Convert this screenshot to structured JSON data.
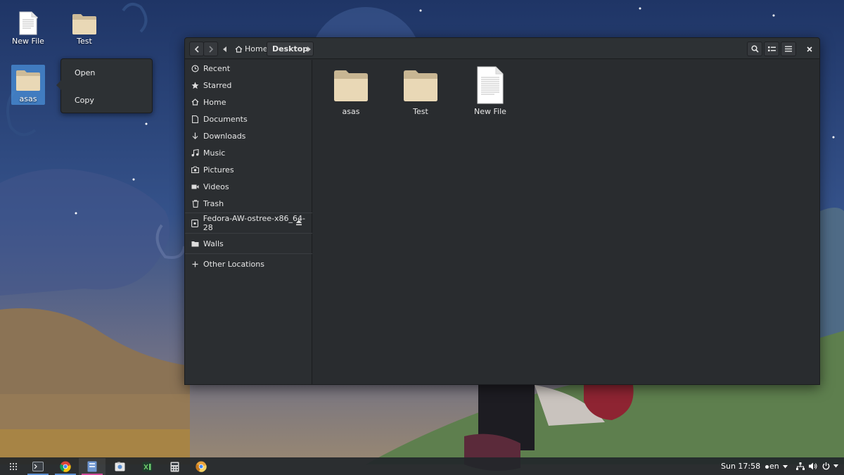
{
  "desktop": {
    "icons": [
      {
        "label": "New File"
      },
      {
        "label": "Test"
      },
      {
        "label": "asas"
      }
    ],
    "context_menu": {
      "items": [
        "Open",
        "Copy"
      ]
    }
  },
  "window": {
    "breadcrumb": {
      "home": "Home",
      "current": "Desktop"
    },
    "sidebar": {
      "items": [
        {
          "label": "Recent",
          "icon": "clock-icon"
        },
        {
          "label": "Starred",
          "icon": "star-icon"
        },
        {
          "label": "Home",
          "icon": "home-icon"
        },
        {
          "label": "Documents",
          "icon": "document-icon"
        },
        {
          "label": "Downloads",
          "icon": "download-icon"
        },
        {
          "label": "Music",
          "icon": "music-icon"
        },
        {
          "label": "Pictures",
          "icon": "camera-icon"
        },
        {
          "label": "Videos",
          "icon": "video-icon"
        },
        {
          "label": "Trash",
          "icon": "trash-icon"
        },
        {
          "label": "Fedora-AW-ostree-x86_64-28",
          "icon": "drive-icon"
        },
        {
          "label": "Walls",
          "icon": "folder-icon"
        },
        {
          "label": "Other Locations",
          "icon": "plus-icon"
        }
      ]
    },
    "files": [
      {
        "label": "asas",
        "type": "folder"
      },
      {
        "label": "Test",
        "type": "folder"
      },
      {
        "label": "New File",
        "type": "file"
      }
    ]
  },
  "taskbar": {
    "clock": "Sun 17:58",
    "keyboard_layout": "en",
    "apps": [
      "apps-grid-icon",
      "terminal-icon",
      "chrome-icon",
      "files-icon",
      "screenshot-icon",
      "code-editor-icon",
      "calculator-icon",
      "chrome-canary-icon"
    ]
  },
  "colors": {
    "accent": "#4a90d9",
    "window_bg": "#292c2f",
    "folder": "#e6d5b5"
  }
}
